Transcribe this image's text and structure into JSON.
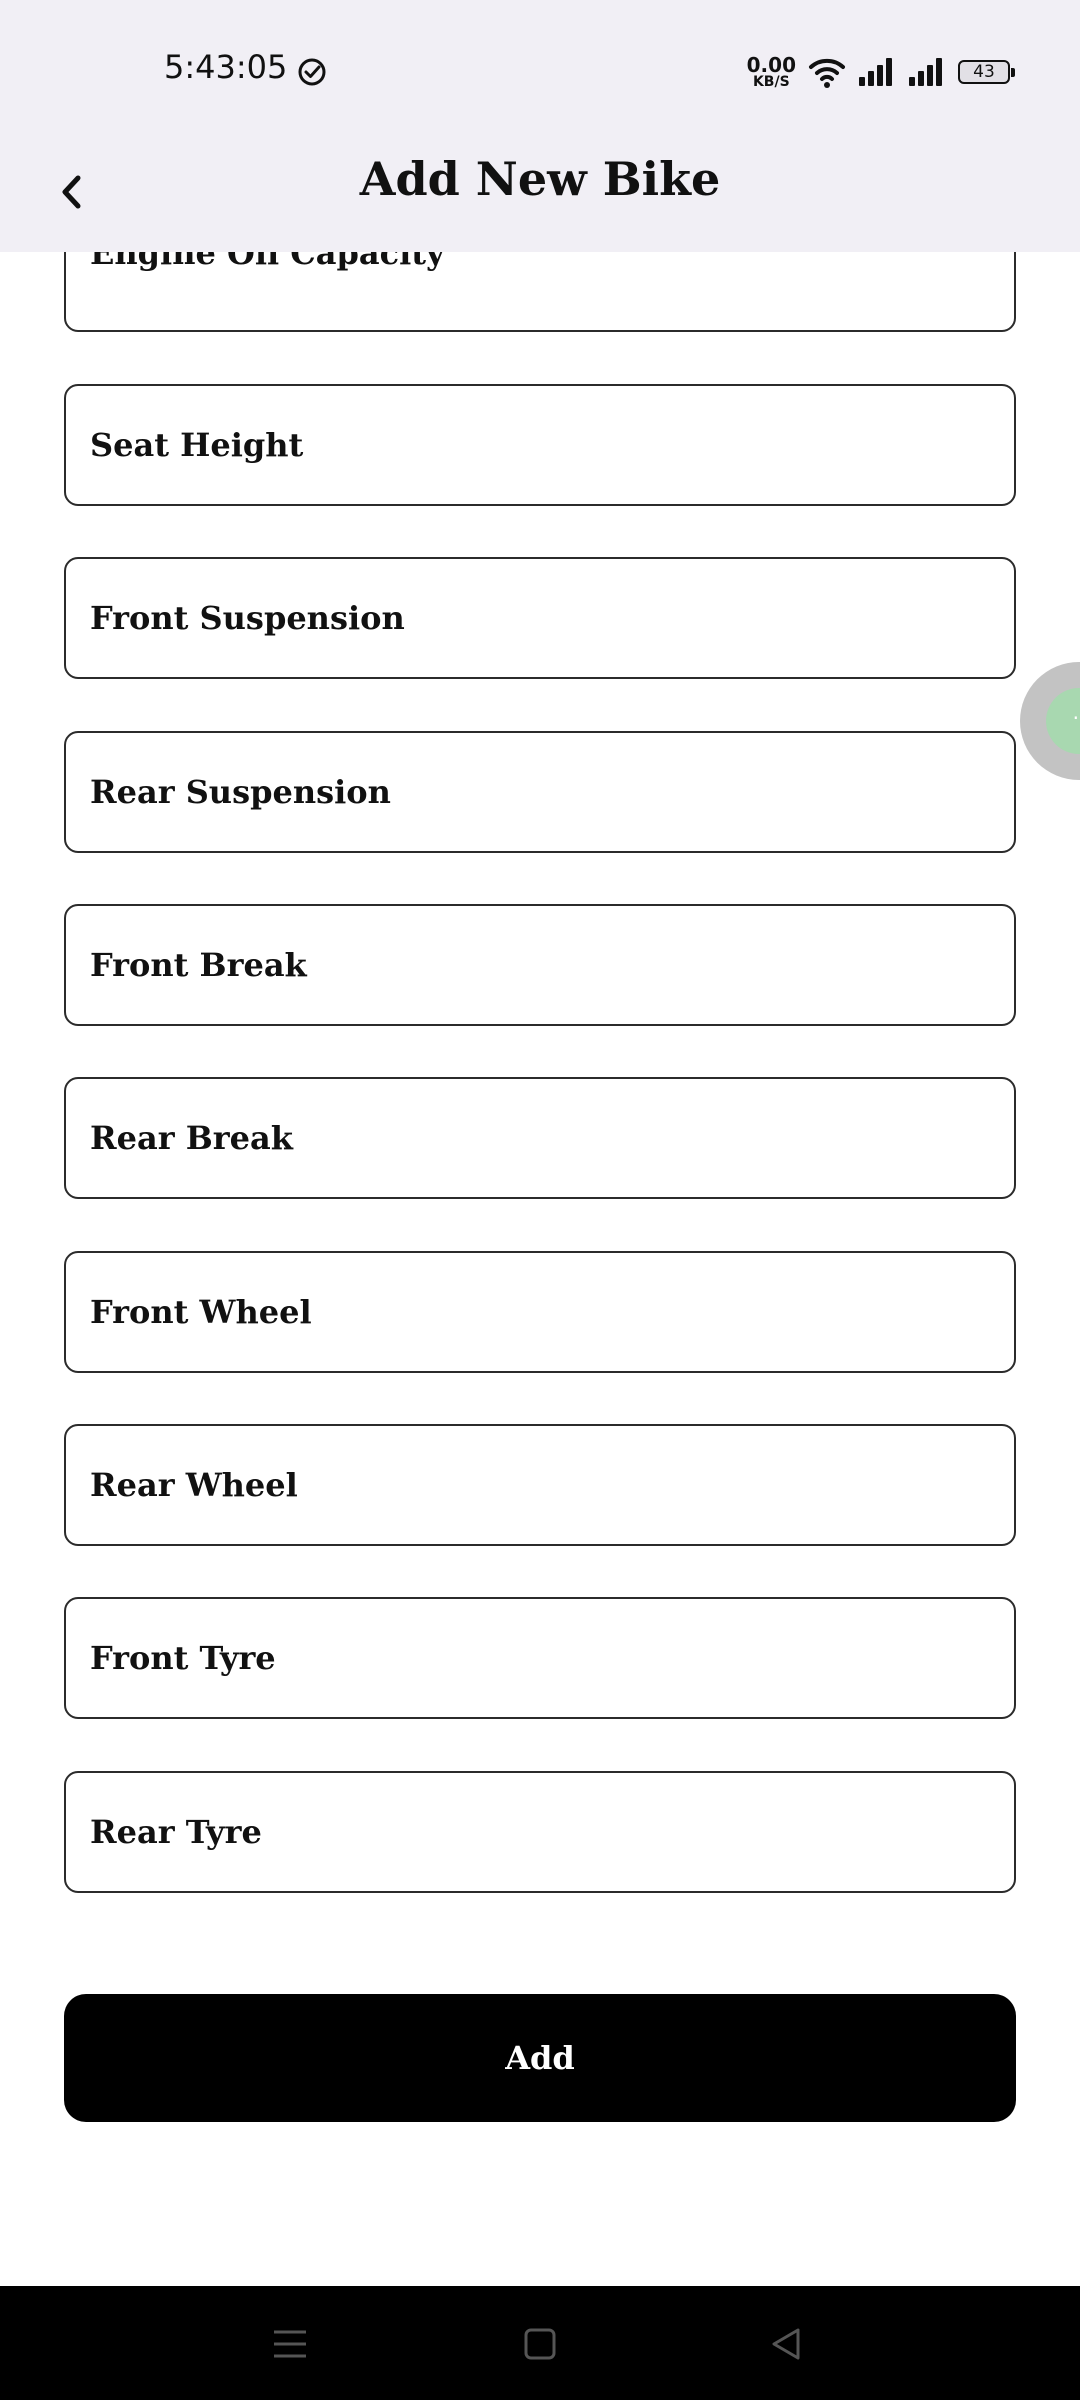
{
  "status_bar": {
    "time": "5:43:05",
    "net_speed_value": "0.00",
    "net_speed_unit": "KB/S",
    "battery_level": "43",
    "icons": [
      "check-circle-icon",
      "wifi-icon",
      "signal-icon",
      "signal-icon",
      "battery-icon"
    ]
  },
  "app_bar": {
    "title": "Add New Bike",
    "back_icon": "chevron-left-icon"
  },
  "form": {
    "fields": [
      {
        "label": "Engine Oil Capacity"
      },
      {
        "label": "Seat Height"
      },
      {
        "label": "Front Suspension"
      },
      {
        "label": "Rear Suspension"
      },
      {
        "label": "Front Break"
      },
      {
        "label": "Rear Break"
      },
      {
        "label": "Front Wheel"
      },
      {
        "label": "Rear Wheel"
      },
      {
        "label": "Front Tyre"
      },
      {
        "label": "Rear Tyre"
      }
    ],
    "submit_label": "Add"
  },
  "floating_bubble": {
    "glyph": "··"
  },
  "nav_bar": {
    "icons": [
      "menu-icon",
      "home-icon",
      "back-triangle-icon"
    ]
  },
  "colors": {
    "bar_background": "#f1eff5",
    "button_background": "#000000",
    "field_border": "#2b2b2b"
  }
}
